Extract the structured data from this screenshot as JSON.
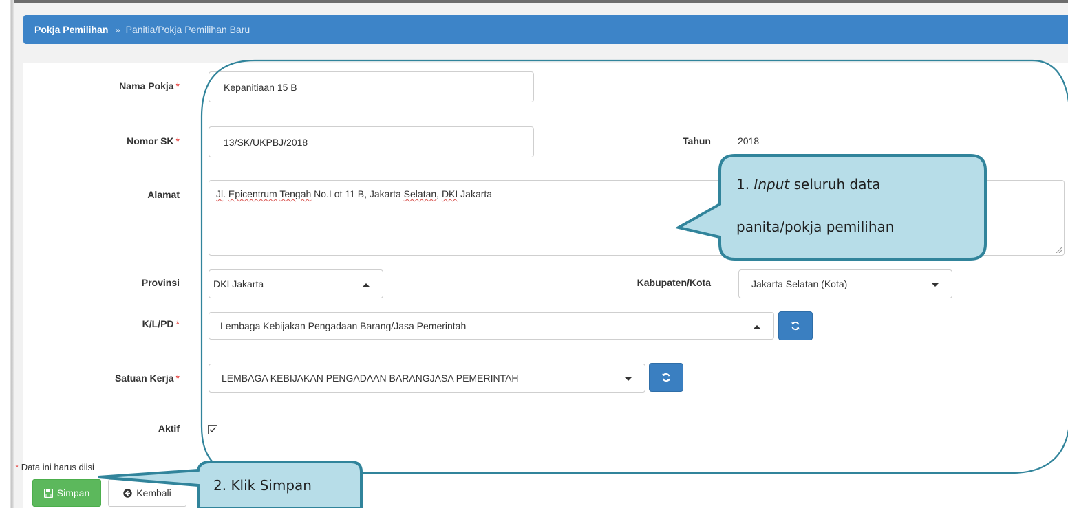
{
  "breadcrumb": {
    "root": "Pokja Pemilihan",
    "separator": "»",
    "current": "Panitia/Pokja Pemilihan Baru"
  },
  "form": {
    "nama_pokja": {
      "label": "Nama Pokja",
      "required_mark": "*",
      "value": "Kepanitiaan 15 B"
    },
    "nomor_sk": {
      "label": "Nomor SK",
      "required_mark": "*",
      "value": "13/SK/UKPBJ/2018"
    },
    "tahun": {
      "label": "Tahun",
      "value": "2018"
    },
    "alamat": {
      "label": "Alamat",
      "value_parts": [
        "Jl",
        ". ",
        "Epicentrum",
        " ",
        "Tengah",
        " No.Lot 11 B, Jakarta ",
        "Selatan",
        ", ",
        "DKI",
        " Jakarta"
      ]
    },
    "provinsi": {
      "label": "Provinsi",
      "value": "DKI Jakarta"
    },
    "kabupaten_kota": {
      "label": "Kabupaten/Kota",
      "value": "Jakarta Selatan (Kota)"
    },
    "klpd": {
      "label": "K/L/PD",
      "required_mark": "*",
      "value": "Lembaga Kebijakan Pengadaan Barang/Jasa Pemerintah"
    },
    "satuan_kerja": {
      "label": "Satuan Kerja",
      "required_mark": "*",
      "value": "LEMBAGA KEBIJAKAN PENGADAAN BARANGJASA PEMERINTAH"
    },
    "aktif": {
      "label": "Aktif",
      "checked": true
    },
    "required_note": {
      "mark": "*",
      "text": "Data ini harus diisi"
    }
  },
  "buttons": {
    "save": {
      "label": "Simpan",
      "icon": "floppy-disk-icon"
    },
    "back": {
      "label": "Kembali",
      "icon": "circle-arrow-left-icon"
    }
  },
  "annotations": {
    "callout_1": {
      "prefix": "1. ",
      "italic": "Input",
      "rest_line1": " seluruh data",
      "line2": "panita/pokja pemilihan"
    },
    "callout_2": {
      "text": "2. Klik Simpan"
    }
  },
  "colors": {
    "header_blue": "#3d84c8",
    "primary_button": "#3a7fc1",
    "save_green": "#5cb85c",
    "callout_fill": "#b7dde8",
    "callout_border": "#31849b",
    "required_red": "#e53935"
  }
}
